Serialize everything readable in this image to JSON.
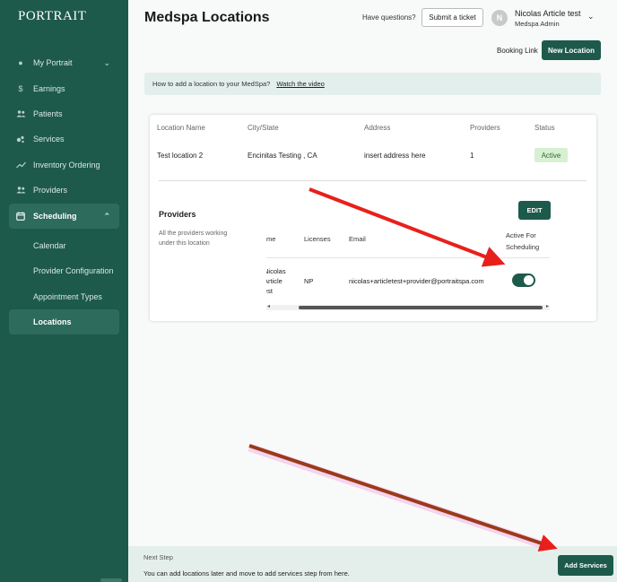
{
  "sidebar": {
    "logo": "PORTRAIT",
    "items": [
      {
        "label": "My Portrait",
        "icon": "my-portrait-icon",
        "glyph": "●",
        "chevron": "⌄"
      },
      {
        "label": "Earnings",
        "icon": "dollar-icon",
        "glyph": "$"
      },
      {
        "label": "Patients",
        "icon": "patients-icon",
        "glyph": "👥"
      },
      {
        "label": "Services",
        "icon": "services-icon",
        "glyph": "●"
      },
      {
        "label": "Inventory Ordering",
        "icon": "trend-icon",
        "glyph": "∿"
      },
      {
        "label": "Providers",
        "icon": "providers-icon",
        "glyph": "👥"
      },
      {
        "label": "Scheduling",
        "icon": "calendar-icon",
        "glyph": "▦",
        "chevron": "⌃"
      }
    ],
    "sub_items": [
      "Calendar",
      "Provider Configuration",
      "Appointment Types",
      "Locations"
    ]
  },
  "header": {
    "title": "Medspa Locations",
    "have_questions": "Have questions?",
    "submit_ticket": "Submit a ticket",
    "user_initial": "N",
    "user_name": "Nicolas Article test",
    "user_role": "Medspa Admin",
    "user_chevron": "⌄",
    "booking_link": "Booking Link",
    "new_location": "New Location"
  },
  "banner": {
    "text": "How to add a location to your MedSpa?",
    "link": "Watch the video"
  },
  "locations_table": {
    "columns": [
      "Location Name",
      "City/State",
      "Address",
      "Providers",
      "Status"
    ],
    "row": {
      "name": "Test location 2",
      "city": "Encinitas Testing , CA",
      "address": "insert address here",
      "providers": "1",
      "status": "Active"
    }
  },
  "providers_section": {
    "title": "Providers",
    "description": "All the providers working under this location",
    "edit": "EDIT",
    "columns": {
      "name": "me",
      "licenses": "Licenses",
      "email": "Email",
      "active": "Active For Scheduling"
    },
    "row": {
      "name": "Nicolas Article est",
      "license": "NP",
      "email": "nicolas+articletest+provider@portraitspa.com",
      "active": true
    },
    "scroll_left": "◂",
    "scroll_right": "▸"
  },
  "footer": {
    "next_step": "Next Step",
    "description": "You can add locations later and move to add services step from here.",
    "add_services": "Add Services"
  },
  "colors": {
    "brand": "#1d5a4c",
    "annotation_red": "#e8201b",
    "annotation_brown": "#9a3a1a"
  }
}
